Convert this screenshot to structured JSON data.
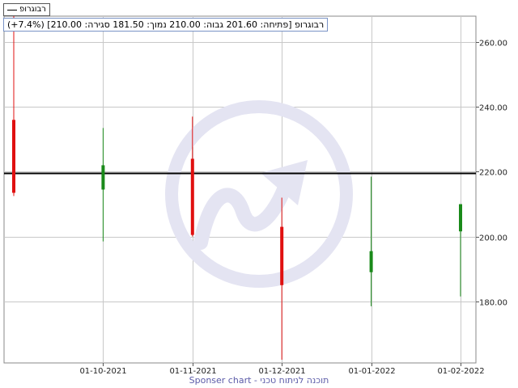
{
  "legend": {
    "series_name": "רבוגרופ"
  },
  "info": {
    "text": "רבוגרופ [פתיחה: 201.60  גבוה: 210.00  נמוך: 181.50  סגירה: 210.00] (7.4%+)"
  },
  "footer": {
    "text": "Sponser chart - תוכנה לניתוח טכני"
  },
  "colors": {
    "up": "#1a8a1a",
    "down": "#e01010",
    "reference_line": "#000000",
    "grid": "#c8c8c8",
    "watermark": "#e4e4f2"
  },
  "chart_data": {
    "type": "candlestick",
    "y_axis_side": "right",
    "ylim": [
      161,
      268
    ],
    "y_ticks": [
      180,
      200,
      220,
      240,
      260
    ],
    "y_tick_labels": [
      "180.00",
      "200.00",
      "220.00",
      "240.00",
      "260.00"
    ],
    "x_tick_labels": [
      "01-10-2021",
      "01-11-2021",
      "01-12-2021",
      "01-01-2022",
      "01-02-2022"
    ],
    "grid": true,
    "reference_line": 219.5,
    "candles": [
      {
        "period": "09-2021",
        "open": 236.0,
        "high": 268.0,
        "low": 212.5,
        "close": 213.5
      },
      {
        "period": "10-2021",
        "open": 214.5,
        "high": 233.5,
        "low": 198.5,
        "close": 222.0
      },
      {
        "period": "11-2021",
        "open": 224.0,
        "high": 237.0,
        "low": 200.0,
        "close": 200.5
      },
      {
        "period": "12-2021",
        "open": 203.0,
        "high": 212.0,
        "low": 162.0,
        "close": 185.0
      },
      {
        "period": "01-2022",
        "open": 189.0,
        "high": 218.5,
        "low": 178.5,
        "close": 195.5
      },
      {
        "period": "02-2022",
        "open": 201.6,
        "high": 210.0,
        "low": 181.5,
        "close": 210.0
      }
    ]
  }
}
